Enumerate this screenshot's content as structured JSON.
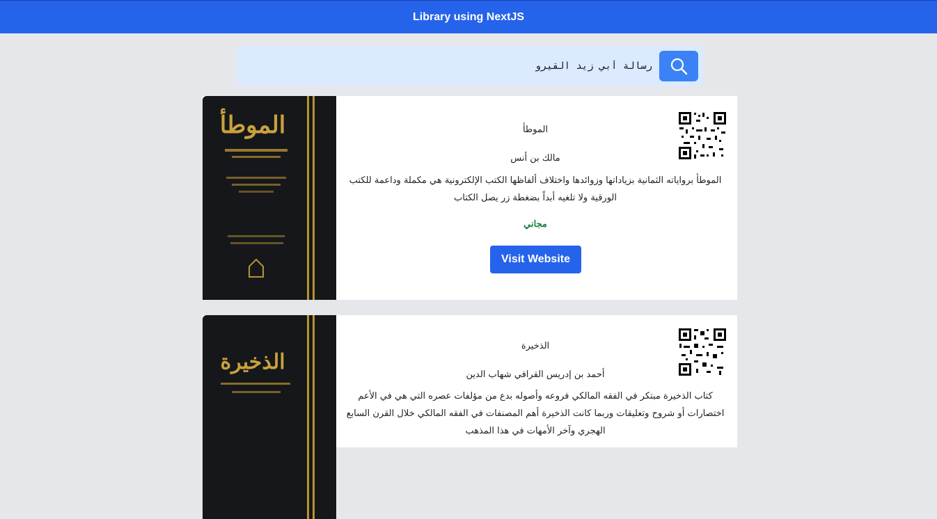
{
  "header": {
    "title": "Library using NextJS"
  },
  "search": {
    "value": "رسالة أبي زيد القيرو",
    "button_icon": "search-icon"
  },
  "books": [
    {
      "cover_title": "الموطأ",
      "title": "الموطأ",
      "author": "مالك بن أنس",
      "description": "الموطأ برواياته الثمانية بزياداتها وزوائدها واختلاف ألفاظها الكتب الإلكترونية هي مكملة وداعمة للكتب الورقية ولا تلغيه أبداً بضغطة زر يصل الكتاب",
      "price": "مجاني",
      "button_label": "Visit Website"
    },
    {
      "cover_title": "الذخيرة",
      "title": "الذخيرة",
      "author": "أحمد بن إدريس القرافي شهاب الدين",
      "description": "كتاب الذخيرة مبتكر في الفقه المالكي فروعه وأصوله بدع من مؤلفات عصره التي هي في الأعم اختصارات أو شروح وتعليقات وربما كانت الذخيرة أهم المصنفات في الفقه المالكي خلال القرن السابع الهجري وآخر الأمهات في هذا المذهب"
    }
  ],
  "colors": {
    "header": "#2563eb",
    "button": "#2563eb",
    "price": "#15803d",
    "background": "#e5e7eb"
  }
}
